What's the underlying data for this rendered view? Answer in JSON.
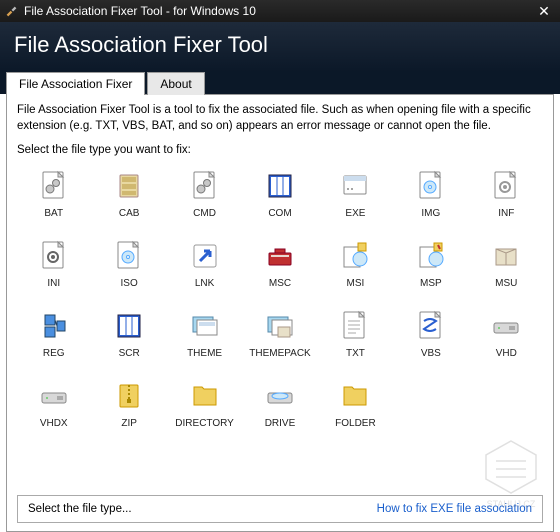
{
  "window": {
    "title": "File Association Fixer Tool - for Windows 10"
  },
  "header": {
    "title": "File Association Fixer Tool"
  },
  "tabs": {
    "main": "File Association Fixer",
    "about": "About"
  },
  "body": {
    "description": "File Association Fixer Tool is a tool to fix the associated file. Such as when opening file with a specific extension (e.g. TXT, VBS, BAT, and so on) appears an error message or cannot open the file.",
    "prompt": "Select the file type you want to fix:"
  },
  "items": [
    {
      "id": "bat",
      "label": "BAT",
      "icon": "gear-page"
    },
    {
      "id": "cab",
      "label": "CAB",
      "icon": "cabinet"
    },
    {
      "id": "cmd",
      "label": "CMD",
      "icon": "gear-page"
    },
    {
      "id": "com",
      "label": "COM",
      "icon": "blue-grid"
    },
    {
      "id": "exe",
      "label": "EXE",
      "icon": "window"
    },
    {
      "id": "img",
      "label": "IMG",
      "icon": "disc-page"
    },
    {
      "id": "inf",
      "label": "INF",
      "icon": "gear-file"
    },
    {
      "id": "ini",
      "label": "INI",
      "icon": "gear-file-dark"
    },
    {
      "id": "iso",
      "label": "ISO",
      "icon": "disc-page"
    },
    {
      "id": "lnk",
      "label": "LNK",
      "icon": "shortcut"
    },
    {
      "id": "msc",
      "label": "MSC",
      "icon": "toolbox"
    },
    {
      "id": "msi",
      "label": "MSI",
      "icon": "installer"
    },
    {
      "id": "msp",
      "label": "MSP",
      "icon": "installer-patch"
    },
    {
      "id": "msu",
      "label": "MSU",
      "icon": "package"
    },
    {
      "id": "reg",
      "label": "REG",
      "icon": "registry"
    },
    {
      "id": "scr",
      "label": "SCR",
      "icon": "blue-grid"
    },
    {
      "id": "theme",
      "label": "THEME",
      "icon": "theme"
    },
    {
      "id": "themepack",
      "label": "THEMEPACK",
      "icon": "theme-pack"
    },
    {
      "id": "txt",
      "label": "TXT",
      "icon": "text-file"
    },
    {
      "id": "vbs",
      "label": "VBS",
      "icon": "script"
    },
    {
      "id": "vhd",
      "label": "VHD",
      "icon": "drive"
    },
    {
      "id": "vhdx",
      "label": "VHDX",
      "icon": "drive"
    },
    {
      "id": "zip",
      "label": "ZIP",
      "icon": "zip"
    },
    {
      "id": "directory",
      "label": "DIRECTORY",
      "icon": "folder"
    },
    {
      "id": "drive",
      "label": "DRIVE",
      "icon": "drive-disc"
    },
    {
      "id": "folder",
      "label": "FOLDER",
      "icon": "folder"
    }
  ],
  "status": {
    "text": "Select the file type...",
    "link": "How to fix EXE file association"
  },
  "watermark": "STAHUJ.CZ"
}
